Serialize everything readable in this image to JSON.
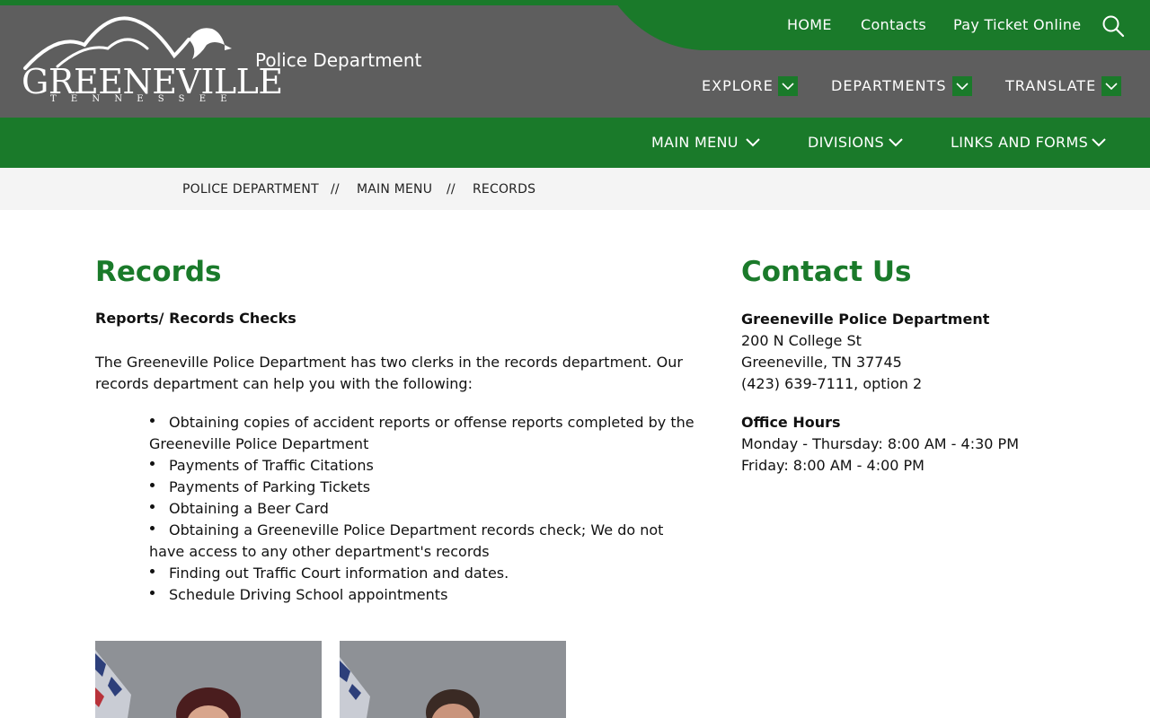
{
  "site": {
    "logo_text": "GREENEVILLE",
    "logo_subtext": "TENNESSEE",
    "name": "Police Department"
  },
  "top_nav": {
    "home": "HOME",
    "contacts": "Contacts",
    "pay_ticket": "Pay Ticket Online"
  },
  "mid_nav": {
    "explore": "EXPLORE",
    "departments": "DEPARTMENTS",
    "translate": "TRANSLATE"
  },
  "green_nav": {
    "main_menu": "MAIN MENU",
    "divisions": "DIVISIONS",
    "links_forms": "LINKS AND FORMS"
  },
  "breadcrumb": {
    "items": [
      "POLICE DEPARTMENT",
      "MAIN MENU",
      "RECORDS"
    ],
    "separator": "//"
  },
  "main": {
    "title": "Records",
    "subtitle": "Reports/ Records Checks",
    "intro": "The Greeneville Police Department has two clerks in the records department. Our records department can help you with the following:",
    "list": [
      "Obtaining copies of accident reports or offense reports completed by the Greeneville Police Department",
      "Payments of Traffic Citations",
      "Payments of Parking Tickets",
      "Obtaining a Beer Card",
      "Obtaining a Greeneville Police Department records check; We do not have access to any other department's records",
      "Finding out Traffic Court information and dates.",
      "Schedule Driving School appointments"
    ]
  },
  "contact": {
    "title": "Contact Us",
    "org": "Greeneville Police Department",
    "address1": "200 N College St",
    "address2": "Greeneville, TN 37745",
    "phone": "(423) 639-7111, option 2",
    "hours_title": "Office Hours",
    "hours1": "Monday - Thursday: 8:00 AM - 4:30 PM",
    "hours2": "Friday: 8:00 AM - 4:00 PM"
  },
  "colors": {
    "brand_green": "#1a7a2a",
    "header_gray": "#5e5e5e",
    "crumb_bg": "#f4f4f4"
  },
  "icons": {
    "search": "search-icon",
    "chevron": "chevron-down-icon"
  }
}
